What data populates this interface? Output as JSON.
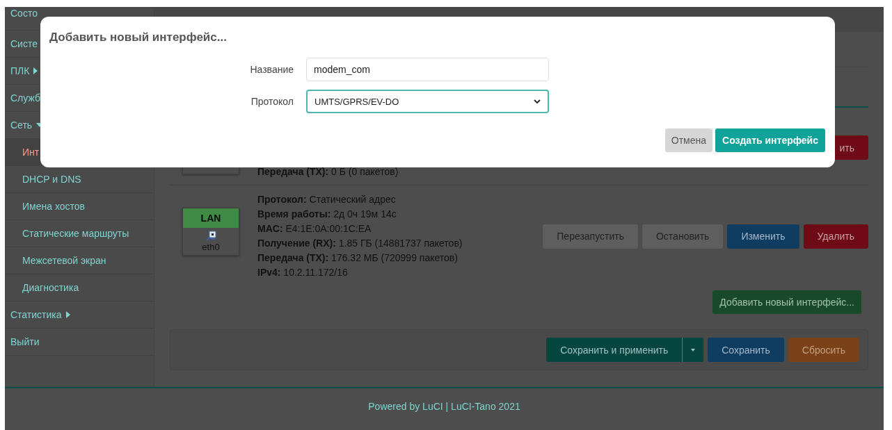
{
  "sidebar": {
    "items": [
      {
        "label": "Состо",
        "selected": false
      },
      {
        "label": "Систе",
        "selected": false
      },
      {
        "label": "ПЛК",
        "expanded": false,
        "selected": false
      },
      {
        "label": "Служб",
        "selected": false
      },
      {
        "label": "Сеть",
        "expanded": true,
        "selected": false,
        "children": [
          {
            "label": "Инт",
            "selected": true
          },
          {
            "label": "DHCP и DNS",
            "selected": false
          },
          {
            "label": "Имена хостов",
            "selected": false
          },
          {
            "label": "Статические маршруты",
            "selected": false
          },
          {
            "label": "Межсетевой экран",
            "selected": false
          },
          {
            "label": "Диагностика",
            "selected": false
          }
        ]
      },
      {
        "label": "Статистика",
        "expanded": false,
        "selected": false
      },
      {
        "label": "Выйти",
        "selected": false
      }
    ]
  },
  "interfaces": [
    {
      "lines": [
        {
          "label": "Передача (TX):",
          "value": "0 Б (0 пакетов)"
        }
      ],
      "buttons": [
        {
          "label": "ить",
          "kind": "delete"
        }
      ]
    },
    {
      "badge": "LAN",
      "device": "eth0",
      "lines": [
        {
          "label": "Протокол:",
          "value": "Статический адрес"
        },
        {
          "label": "Время работы:",
          "value": "2д 0ч 19м 14с"
        },
        {
          "label": "MAC:",
          "value": "E4:1E:0A:00:1C:EA"
        },
        {
          "label": "Получение (RX):",
          "value": "1.85 ГБ (14881737 пакетов)"
        },
        {
          "label": "Передача (TX):",
          "value": "176.32 МБ (720999 пакетов)"
        },
        {
          "label": "IPv4:",
          "value": "10.2.11.172/16"
        }
      ],
      "buttons": [
        {
          "label": "Перезапустить",
          "kind": "neutral"
        },
        {
          "label": "Остановить",
          "kind": "neutral"
        },
        {
          "label": "Изменить",
          "kind": "edit"
        },
        {
          "label": "Удалить",
          "kind": "delete"
        }
      ]
    }
  ],
  "add_button": "Добавить новый интерфейс...",
  "actions": [
    {
      "label": "Сохранить и применить",
      "kind": "apply"
    },
    {
      "label": "Сохранить",
      "kind": "save"
    },
    {
      "label": "Сбросить",
      "kind": "reset"
    }
  ],
  "footer": "Powered by LuCI | LuCI-Tano 2021",
  "modal": {
    "title": "Добавить новый интерфейс...",
    "fields": [
      {
        "label": "Название",
        "value": "modem_com",
        "kind": "text"
      },
      {
        "label": "Протокол",
        "value": "UMTS/GPRS/EV-DO",
        "kind": "select"
      }
    ],
    "buttons": [
      {
        "label": "Отмена",
        "kind": "cancel"
      },
      {
        "label": "Создать интерфейс",
        "kind": "primary"
      }
    ]
  }
}
